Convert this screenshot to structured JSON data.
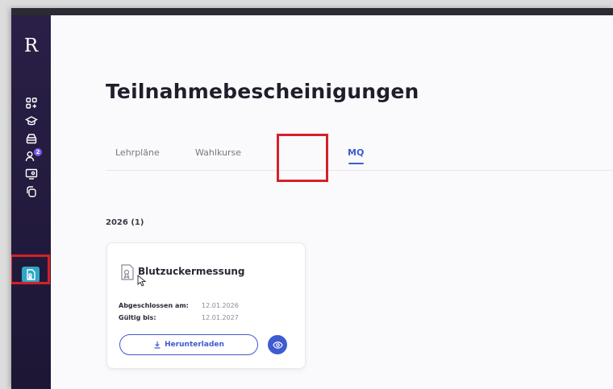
{
  "sidebar": {
    "logo": "R",
    "badge_count": "2",
    "items": [
      {
        "icon": "dashboard-plus-icon"
      },
      {
        "icon": "graduation-cap-icon"
      },
      {
        "icon": "archive-box-icon"
      },
      {
        "icon": "users-icon"
      },
      {
        "icon": "monitor-user-icon"
      },
      {
        "icon": "copy-icon"
      },
      {
        "icon": "certificate-icon",
        "active": true
      }
    ]
  },
  "page": {
    "title": "Teilnahmebescheinigungen"
  },
  "tabs": [
    {
      "label": "Lehrpläne"
    },
    {
      "label": "Wahlkurse"
    },
    {
      "label": "MQ",
      "active": true
    }
  ],
  "section": {
    "year_label": "2026 (1)"
  },
  "certificate": {
    "title": "Blutzuckermessung",
    "completed_label": "Abgeschlossen am:",
    "completed_value": "12.01.2026",
    "valid_label": "Gültig bis:",
    "valid_value": "12.01.2027",
    "download_label": "Herunterladen",
    "view_icon": "eye-icon"
  },
  "colors": {
    "accent": "#3f5bd1",
    "sidebar_bg": "#2a1f47",
    "active_nav": "#2fa6c7",
    "highlight": "#d6202a"
  }
}
